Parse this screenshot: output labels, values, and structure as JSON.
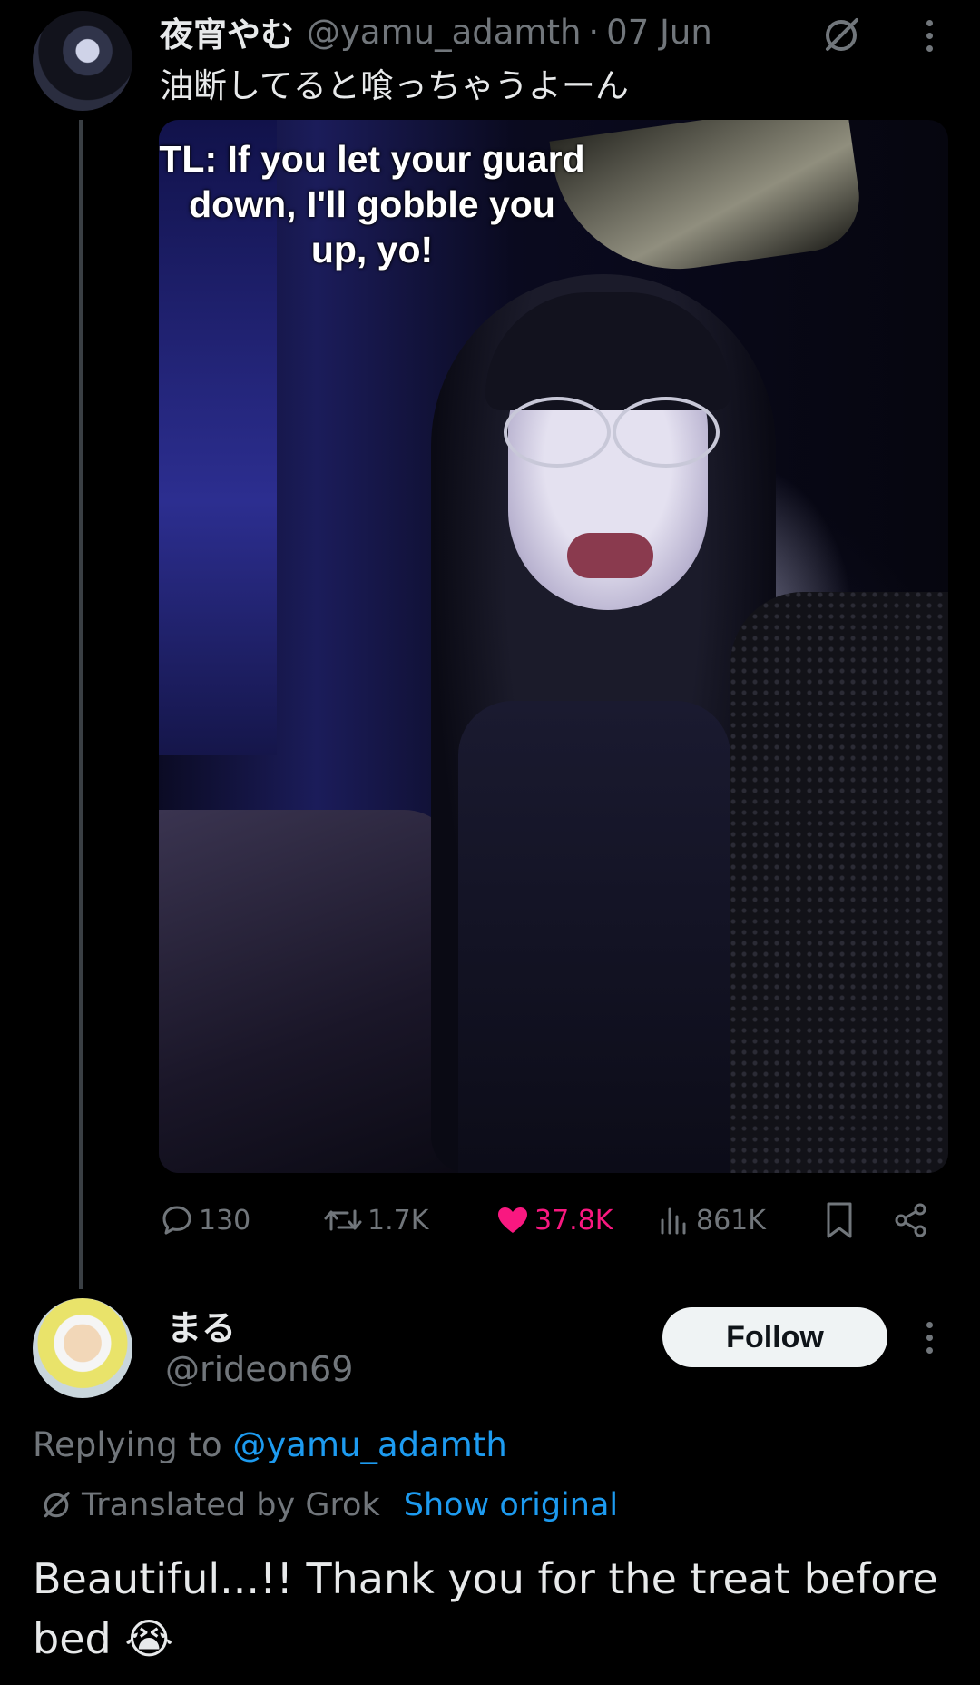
{
  "tweet": {
    "display_name": "夜宵やむ",
    "handle": "@yamu_adamth",
    "separator": "·",
    "date": "07 Jun",
    "text": "油断してると喰っちゃうよーん",
    "image": {
      "caption": "TL: If you let your guard down, I'll gobble you up, yo!"
    },
    "actions": {
      "replies": "130",
      "reposts": "1.7K",
      "likes": "37.8K",
      "views": "861K"
    },
    "icons": {
      "grok": "grok-translate-icon",
      "more": "more-vertical-icon",
      "reply": "comment-icon",
      "repost": "repost-icon",
      "like": "heart-icon",
      "views": "analytics-icon",
      "bookmark": "bookmark-icon",
      "share": "share-icon"
    },
    "colors": {
      "like": "#f91880",
      "muted": "#71767b"
    }
  },
  "reply": {
    "display_name": "まる",
    "handle": "@rideon69",
    "follow_label": "Follow",
    "replying_prefix": "Replying to",
    "replying_to": "@yamu_adamth",
    "translated_label": "Translated by Grok",
    "show_original": "Show original",
    "text": "Beautiful...!! Thank you for the treat before bed 😭",
    "colors": {
      "link": "#1d9bf0",
      "follow_bg": "#eff3f4"
    }
  }
}
